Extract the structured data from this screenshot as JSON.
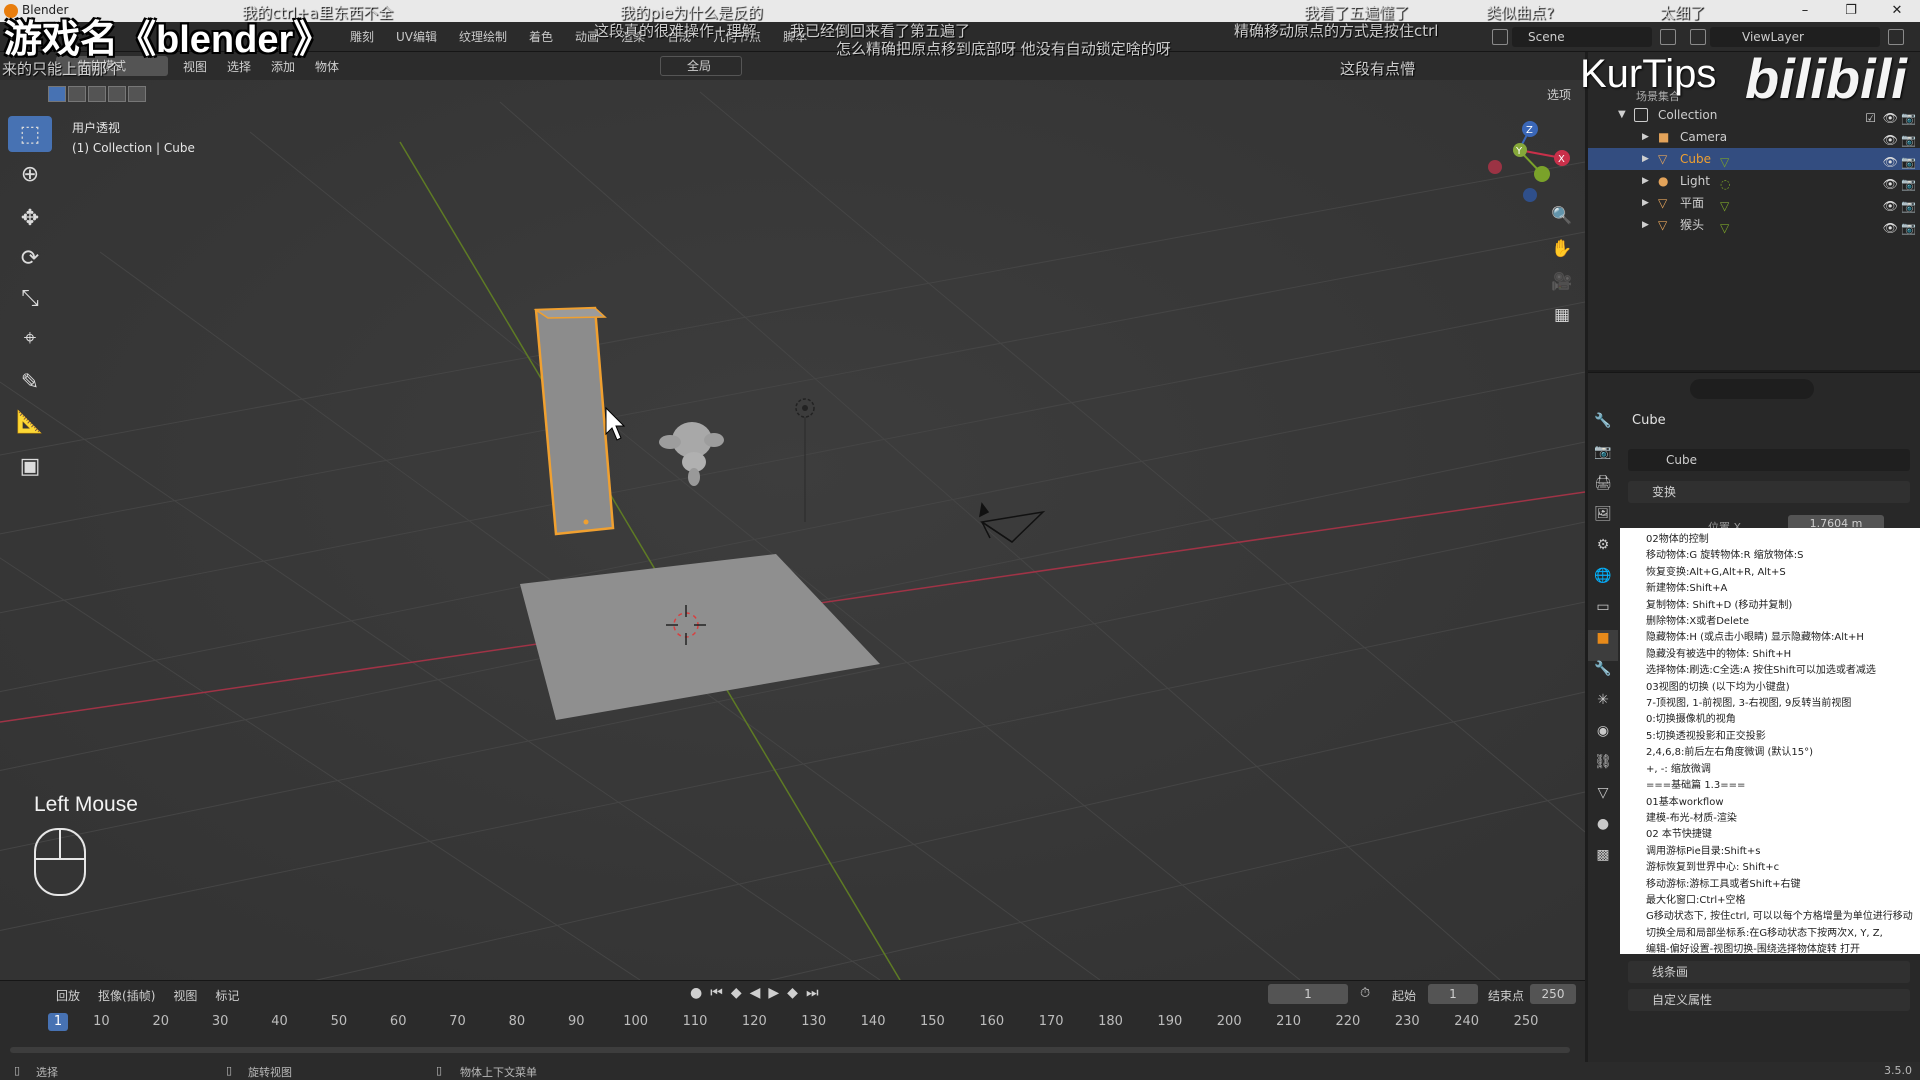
{
  "window": {
    "title": "Blender",
    "controls": [
      "–",
      "❐",
      "✕"
    ]
  },
  "overlay": {
    "game_title": "游戏名《blender》",
    "danmaku": [
      "我的ctrl+a里东西不全",
      "我的pie为什么是反的",
      "这段真的很难操作+理解",
      "我已经倒回来看了第五遍了",
      "精确移动原点的方式是按住ctrl",
      "怎么精确把原点移到底部呀 他没有自动锁定啥的呀",
      "我看了五遍懂了",
      "类似曲点?",
      "太细了",
      "来的只能上面那个",
      "这段有点懵"
    ],
    "watermark_kurtips": "KurTips",
    "watermark_bilibili": "bilibili"
  },
  "topbar": {
    "workspace_tabs": [
      "雕刻",
      "UV编辑",
      "纹理绘制",
      "着色",
      "动画",
      "渲染",
      "合成",
      "几何节点",
      "脚本"
    ],
    "scene": "Scene",
    "view_layer": "ViewLayer"
  },
  "viewport": {
    "mode": "物体模式",
    "menu": [
      "视图",
      "选择",
      "添加",
      "物体"
    ],
    "transform_orientation": "全局",
    "options": "选项",
    "info_line1": "用户透视",
    "info_line2": "(1) Collection | Cube",
    "last_input": "Left Mouse"
  },
  "outliner": {
    "scene_collection": "场景集合",
    "collection": "Collection",
    "items": [
      {
        "label": "Camera",
        "color": "#e3a35a"
      },
      {
        "label": "Cube",
        "color": "#e3a35a",
        "selected": true
      },
      {
        "label": "Light",
        "color": "#e3a35a"
      },
      {
        "label": "平面",
        "color": "#e3a35a"
      },
      {
        "label": "猴头",
        "color": "#e3a35a"
      }
    ]
  },
  "properties": {
    "object_name": "Cube",
    "object_field": "Cube",
    "transform_panel": "变换",
    "location_label": "位置 X",
    "location_value": "1.7604 m",
    "lineart_panel": "线条画",
    "custom_props_panel": "自定义属性"
  },
  "notes": [
    "02物体的控制",
    "移动物体:G          旋转物体:R          缩放物体:S",
    "恢复变换:Alt+G,Alt+R,  Alt+S",
    "新建物体:Shift+A",
    "复制物体: Shift+D  (移动并复制)",
    "删除物体:X或者Delete",
    "隐藏物体:H  (或点击小眼睛)           显示隐藏物体:Alt+H",
    "隐藏没有被选中的物体: Shift+H",
    "选择物体:刷选:C全选:A             按住Shift可以加选或者减选",
    "03视图的切换  (以下均为小键盘)",
    "7-顶视图, 1-前视图, 3-右视图, 9反转当前视图",
    "0:切换摄像机的视角",
    "5:切换透视投影和正交投影",
    "2,4,6,8:前后左右角度微调  (默认15°)",
    "+, -: 缩放微调",
    "===基础篇 1.3===",
    "01基本workflow",
    "建模-布光-材质-渲染",
    "02 本节快捷键",
    "调用游标Pie目录:Shift+s",
    "游标恢复到世界中心: Shift+c",
    "移动游标:游标工具或者Shift+右键",
    "最大化窗口:Ctrl+空格",
    "G移动状态下, 按住ctrl, 可以以每个方格增量为单位进行移动",
    "切换全局和局部坐标系:在G移动状态下按两次X, Y, Z,",
    "编辑-偏好设置-视图切换-围绕选择物体旋转  打开"
  ],
  "timeline": {
    "menu": [
      "回放",
      "抠像(插帧)",
      "视图",
      "标记"
    ],
    "current_frame": "1",
    "start_label": "起始",
    "start": "1",
    "end_label": "结束点",
    "end": "250",
    "ruler": [
      "1",
      "10",
      "20",
      "30",
      "40",
      "50",
      "60",
      "70",
      "80",
      "90",
      "100",
      "110",
      "120",
      "130",
      "140",
      "150",
      "160",
      "170",
      "180",
      "190",
      "200",
      "210",
      "220",
      "230",
      "240",
      "250"
    ],
    "playhead": "1"
  },
  "statusbar": {
    "select": "选择",
    "rotate": "旋转视图",
    "context_menu": "物体上下文菜单",
    "version": "3.5.0"
  },
  "colors": {
    "accent": "#4772b3",
    "selection_orange": "#f0a030",
    "x_axis": "#c9304a",
    "y_axis": "#7aa22a"
  }
}
